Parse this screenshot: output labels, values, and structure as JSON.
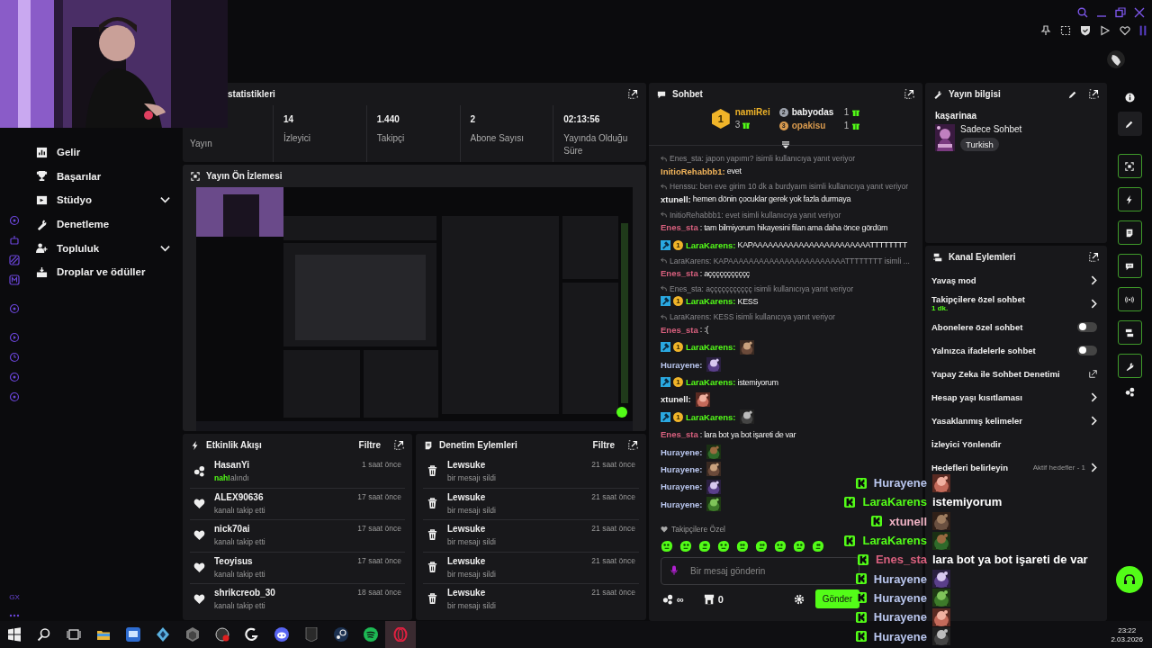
{
  "sidebar": {
    "items": [
      {
        "label": "Gelir",
        "has_submenu": false
      },
      {
        "label": "Başarılar",
        "has_submenu": false
      },
      {
        "label": "Stüdyo",
        "has_submenu": true
      },
      {
        "label": "Denetleme",
        "has_submenu": false
      },
      {
        "label": "Topluluk",
        "has_submenu": true
      },
      {
        "label": "Droplar ve ödüller",
        "has_submenu": false
      }
    ],
    "browser_label": "GX"
  },
  "stats": {
    "title": "statistikleri",
    "items": [
      {
        "label": "Yayın"
      },
      {
        "value": "14",
        "label": "İzleyici"
      },
      {
        "value": "1.440",
        "label": "Takipçi"
      },
      {
        "value": "2",
        "label": "Abone Sayısı"
      },
      {
        "value": "02:13:56",
        "label": "Yayında Olduğu Süre"
      }
    ]
  },
  "preview": {
    "title": "Yayın Ön İzlemesi"
  },
  "activity": {
    "title": "Etkinlik Akışı",
    "filter": "Filtre",
    "items": [
      {
        "kind": "reward",
        "user": "HasanYi",
        "highlight": "nah!",
        "action": "alındı",
        "time": "1 saat önce"
      },
      {
        "kind": "follow",
        "user": "ALEX90636",
        "action": "kanalı takip etti",
        "time": "17 saat önce"
      },
      {
        "kind": "follow",
        "user": "nick70ai",
        "action": "kanalı takip etti",
        "time": "17 saat önce"
      },
      {
        "kind": "follow",
        "user": "Teoyisus",
        "action": "kanalı takip etti",
        "time": "17 saat önce"
      },
      {
        "kind": "follow",
        "user": "shrikcreob_30",
        "action": "kanalı takip etti",
        "time": "18 saat önce"
      }
    ]
  },
  "moderation": {
    "title": "Denetim Eylemleri",
    "filter": "Filtre",
    "items": [
      {
        "user": "Lewsuke",
        "action": "bir mesajı sildi",
        "time": "21 saat önce"
      },
      {
        "user": "Lewsuke",
        "action": "bir mesajı sildi",
        "time": "21 saat önce"
      },
      {
        "user": "Lewsuke",
        "action": "bir mesajı sildi",
        "time": "21 saat önce"
      },
      {
        "user": "Lewsuke",
        "action": "bir mesajı sildi",
        "time": "21 saat önce"
      },
      {
        "user": "Lewsuke",
        "action": "bir mesajı sildi",
        "time": "21 saat önce"
      }
    ]
  },
  "chat": {
    "title": "Sohbet",
    "leaders": [
      {
        "rank": "1",
        "name": "namiRei",
        "count": "3",
        "color": "#f0b429"
      },
      {
        "rank": "2",
        "name": "babyodas",
        "count": "1",
        "color": "#9ea3ad"
      },
      {
        "rank": "3",
        "name": "opakisu",
        "count": "1",
        "color": "#d99a4e"
      }
    ],
    "messages": [
      {
        "reply_to": "Enes_sta: japon yapımı? isimli kullanıcıya yanıt veriyor",
        "user": "InitioRehabbb1:",
        "color": "#f0b35a",
        "text": "evet"
      },
      {
        "reply_to": "Henssu: ben eve girim 10 dk a burdyaım isimli kullanıcıya yanıt veriyor",
        "user": "xtunell:",
        "color": "#eeeeee",
        "text": "hemen dönin çocuklar gerek yok fazla durmaya"
      },
      {
        "reply_to": "InitioRehabbb1: evet isimli kullanıcıya yanıt veriyor",
        "user": "Enes_sta",
        "color": "#d9607e",
        "text": ": tam bilmiyorum hikayesini filan ama daha önce gördüm"
      },
      {
        "badge_rank": "1",
        "user": "LaraKarens:",
        "color": "#53fc18",
        "text": "KAPAAAAAAAAAAAAAAAAAAAAAAATTTTTTTT"
      },
      {
        "reply_to": "LaraKarens: KAPAAAAAAAAAAAAAAAAAAAAAAATTTTTTTT isimli ...",
        "user": "Enes_sta",
        "color": "#d9607e",
        "text": ": aççççççççççç"
      },
      {
        "reply_to": "Enes_sta: aççççççççççç isimli kullanıcıya yanıt veriyor",
        "badge_rank": "1",
        "user": "LaraKarens:",
        "color": "#53fc18",
        "text": "KESS"
      },
      {
        "reply_to": "LaraKarens: KESS isimli kullanıcıya yanıt veriyor",
        "user": "Enes_sta",
        "color": "#d9607e",
        "text": ": :("
      },
      {
        "badge_rank": "1",
        "user": "LaraKarens:",
        "color": "#53fc18",
        "emote": true
      },
      {
        "user": "Hurayene:",
        "color": "#b9c6ee",
        "emote": true
      },
      {
        "badge_rank": "1",
        "user": "LaraKarens:",
        "color": "#53fc18",
        "text": "istemiyorum"
      },
      {
        "user": "xtunell:",
        "color": "#eeeeee",
        "emote": true
      },
      {
        "badge_rank": "1",
        "user": "LaraKarens:",
        "color": "#53fc18",
        "emote": true
      },
      {
        "user": "Enes_sta",
        "color": "#d9607e",
        "text": ": lara bot ya bot işareti de var"
      },
      {
        "user": "Hurayene:",
        "color": "#b9c6ee",
        "emote": true
      },
      {
        "user": "Hurayene:",
        "color": "#b9c6ee",
        "emote": true
      },
      {
        "user": "Hurayene:",
        "color": "#b9c6ee",
        "emote": true
      },
      {
        "user": "Hurayene:",
        "color": "#b9c6ee",
        "emote": true
      }
    ],
    "followers_only": "Takipçilere Özel",
    "input_placeholder": "Bir mesaj gönderin",
    "points": "∞",
    "store_count": "0",
    "send": "Gönder"
  },
  "stream_info": {
    "title": "Yayın bilgisi",
    "channel": "kaşarinaa",
    "category": "Sadece Sohbet",
    "tag": "Turkish"
  },
  "channel_actions": {
    "title": "Kanal Eylemleri",
    "items": [
      {
        "kind": "link",
        "label": "Yavaş mod"
      },
      {
        "kind": "link",
        "label": "Takipçilere özel sohbet",
        "detail": "1 dk."
      },
      {
        "kind": "toggle",
        "label": "Abonelere özel sohbet",
        "on": false
      },
      {
        "kind": "toggle",
        "label": "Yalnızca ifadelerle sohbet",
        "on": false
      },
      {
        "kind": "external",
        "label": "Yapay Zeka ile Sohbet Denetimi"
      },
      {
        "kind": "link",
        "label": "Hesap yaşı kısıtlaması"
      },
      {
        "kind": "link",
        "label": "Yasaklanmış kelimeler"
      },
      {
        "kind": "plain",
        "label": "İzleyici Yönlendir"
      },
      {
        "kind": "link",
        "label": "Hedefleri belirleyin",
        "status": "Aktif hedefler - 1"
      }
    ]
  },
  "overlay": [
    {
      "user": "Hurayene",
      "color": "#b9c6ee",
      "emote": true
    },
    {
      "user": "LaraKarens",
      "color": "#53fc18",
      "text": "istemiyorum"
    },
    {
      "user": "xtunell",
      "color": "#f0b3c4",
      "emote": true
    },
    {
      "user": "LaraKarens",
      "color": "#53fc18",
      "emote": true
    },
    {
      "user": "Enes_sta",
      "color": "#d9607e",
      "text": "lara bot ya bot işareti de var"
    },
    {
      "user": "Hurayene",
      "color": "#b9c6ee",
      "emote": true
    },
    {
      "user": "Hurayene",
      "color": "#b9c6ee",
      "emote": true
    },
    {
      "user": "Hurayene",
      "color": "#b9c6ee",
      "emote": true
    },
    {
      "user": "Hurayene",
      "color": "#b9c6ee",
      "emote": true
    }
  ],
  "clock": {
    "time": "23:22",
    "date": "2.03.2026"
  }
}
